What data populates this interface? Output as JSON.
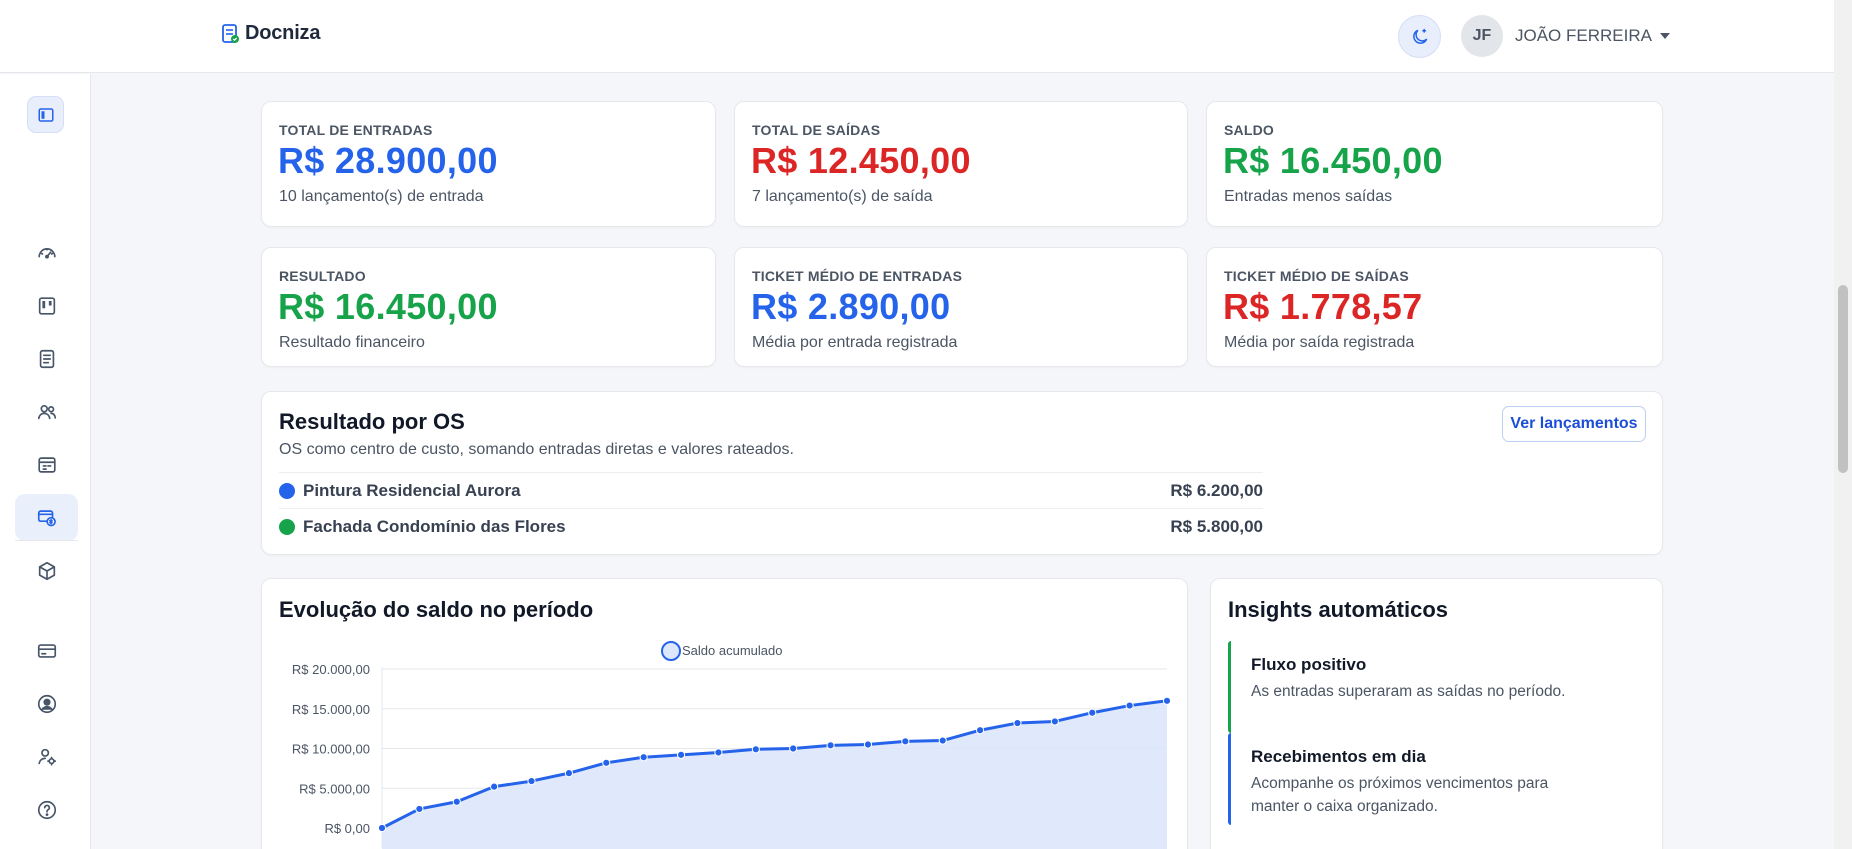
{
  "brand": {
    "name": "Docniza"
  },
  "header": {
    "theme_toggle_icon": "moon-icon",
    "user": {
      "initials": "JF",
      "name": "JOÃO FERREIRA"
    }
  },
  "sidebar": {
    "items": [
      {
        "name": "dashboard",
        "icon": "gauge-icon"
      },
      {
        "name": "kanban",
        "icon": "kanban-icon"
      },
      {
        "name": "documents",
        "icon": "document-list-icon"
      },
      {
        "name": "clients",
        "icon": "users-icon"
      },
      {
        "name": "calendar",
        "icon": "calendar-icon"
      },
      {
        "name": "finance",
        "icon": "money-icon",
        "active": true
      },
      {
        "name": "products",
        "icon": "box-icon"
      },
      {
        "name": "billing",
        "icon": "credit-card-icon"
      },
      {
        "name": "profile",
        "icon": "user-circle-icon"
      },
      {
        "name": "user-settings",
        "icon": "user-gear-icon"
      },
      {
        "name": "help",
        "icon": "help-icon"
      },
      {
        "name": "gifts",
        "icon": "gift-icon"
      }
    ]
  },
  "stats": [
    {
      "label": "TOTAL DE ENTRADAS",
      "value": "R$ 28.900,00",
      "desc": "10 lançamento(s) de entrada",
      "color": "blue"
    },
    {
      "label": "TOTAL DE SAÍDAS",
      "value": "R$ 12.450,00",
      "desc": "7 lançamento(s) de saída",
      "color": "red"
    },
    {
      "label": "SALDO",
      "value": "R$ 16.450,00",
      "desc": "Entradas menos saídas",
      "color": "green"
    },
    {
      "label": "RESULTADO",
      "value": "R$ 16.450,00",
      "desc": "Resultado financeiro",
      "color": "green"
    },
    {
      "label": "TICKET MÉDIO DE ENTRADAS",
      "value": "R$ 2.890,00",
      "desc": "Média por entrada registrada",
      "color": "blue"
    },
    {
      "label": "TICKET MÉDIO DE SAÍDAS",
      "value": "R$ 1.778,57",
      "desc": "Média por saída registrada",
      "color": "red"
    }
  ],
  "os_result": {
    "title": "Resultado por OS",
    "subtitle": "OS como centro de custo, somando entradas diretas e valores rateados.",
    "button": "Ver lançamentos",
    "rows": [
      {
        "name": "Pintura Residencial Aurora",
        "value": "R$ 6.200,00",
        "color": "#2563eb"
      },
      {
        "name": "Fachada Condomínio das Flores",
        "value": "R$ 5.800,00",
        "color": "#16a34a"
      }
    ]
  },
  "chart_card": {
    "title": "Evolução do saldo no período"
  },
  "chart_data": {
    "type": "area",
    "title": "Evolução do saldo no período",
    "legend": "top-center",
    "series": [
      {
        "name": "Saldo acumulado",
        "values": [
          0,
          2400,
          3300,
          5200,
          5900,
          6900,
          8200,
          8900,
          9200,
          9500,
          9900,
          10000,
          10400,
          10500,
          10900,
          11000,
          12300,
          13200,
          13400,
          14500,
          15400,
          16000
        ]
      }
    ],
    "y_ticks": [
      "R$ 20.000,00",
      "R$ 15.000,00",
      "R$ 10.000,00",
      "R$ 5.000,00",
      "R$ 0,00"
    ],
    "ylim": [
      0,
      20000
    ],
    "grid": true,
    "color": "#2563eb"
  },
  "insights": {
    "title": "Insights automáticos",
    "items": [
      {
        "title": "Fluxo positivo",
        "text": "As entradas superaram as saídas no período.",
        "color": "#16a34a"
      },
      {
        "title": "Recebimentos em dia",
        "text": "Acompanhe os próximos vencimentos para manter o caixa organizado.",
        "color": "#2563eb"
      }
    ]
  }
}
